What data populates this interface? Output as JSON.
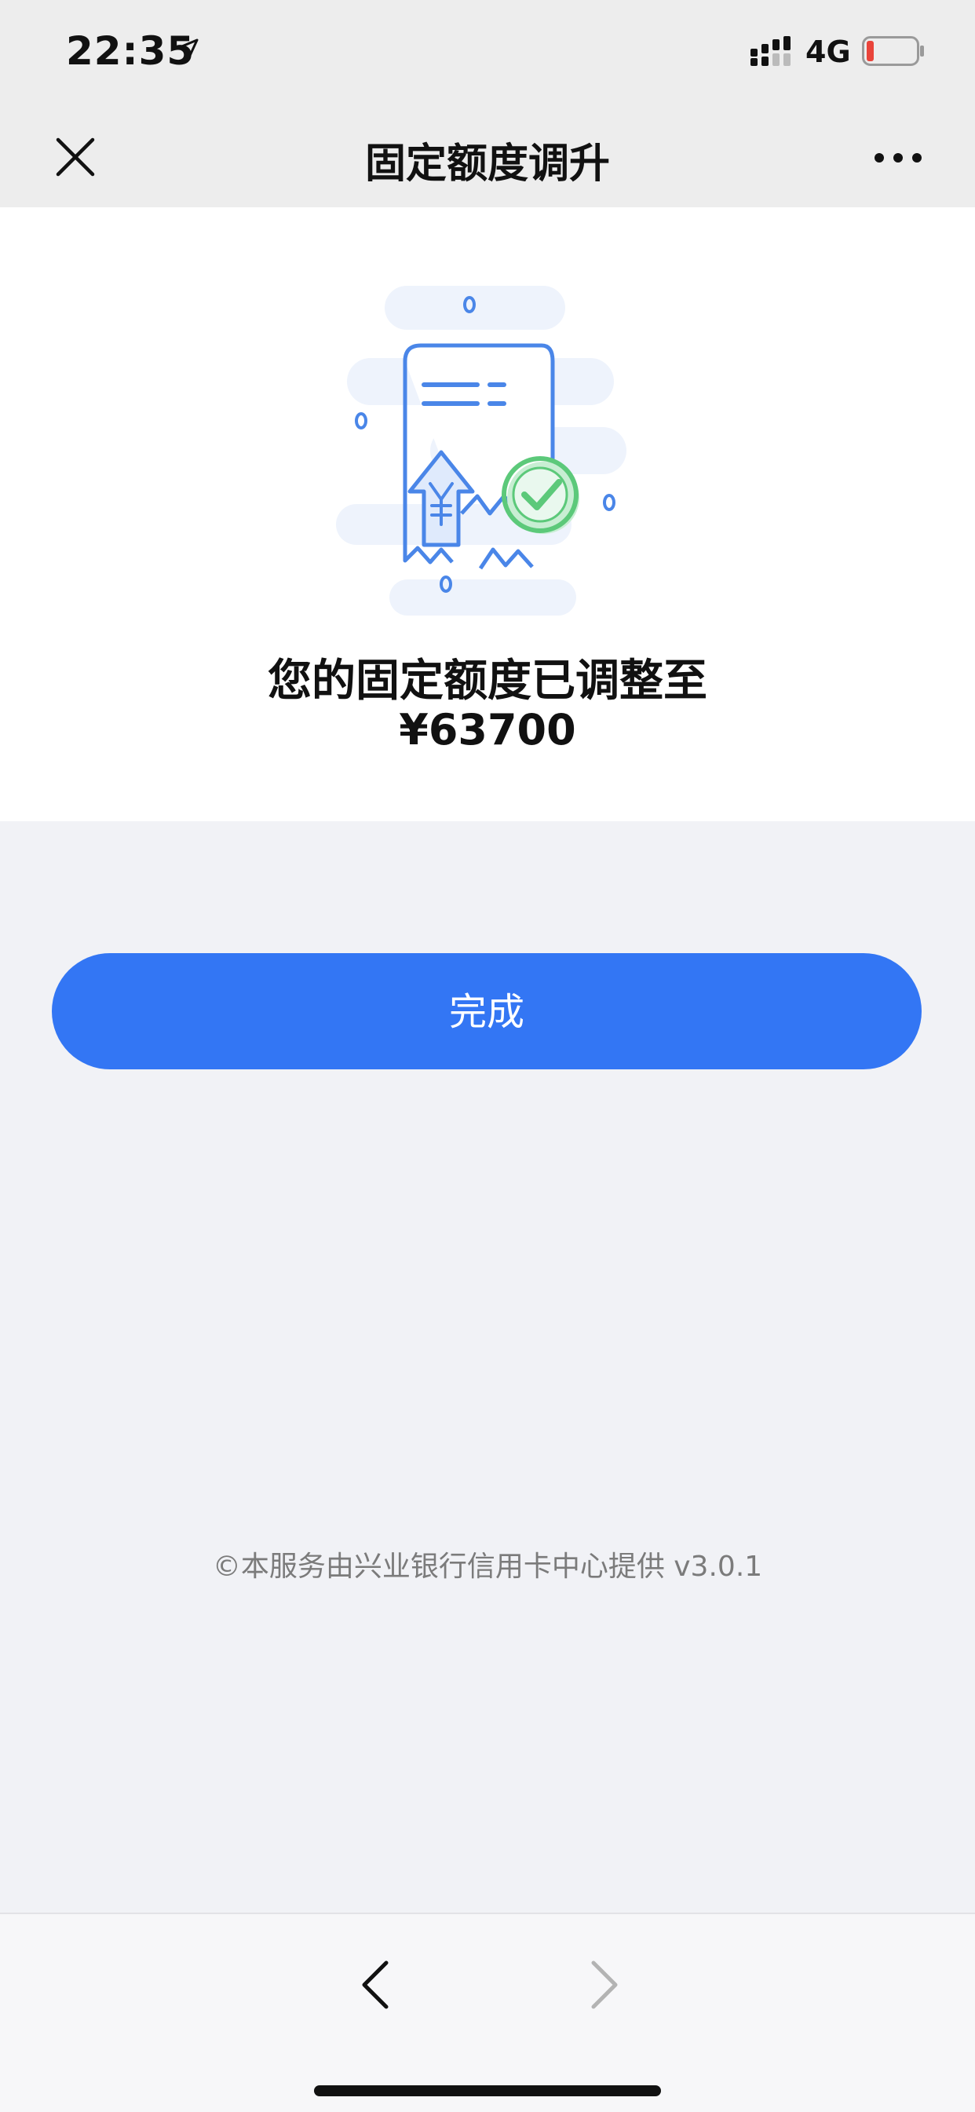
{
  "status_bar": {
    "time": "22:35",
    "network": "4G",
    "icons": [
      "location-arrow-icon",
      "signal-bars-icon",
      "battery-low-icon"
    ],
    "battery_color": "#e9443a"
  },
  "nav": {
    "title": "固定额度调升",
    "icons": [
      "close-icon",
      "more-dots-icon"
    ]
  },
  "result": {
    "message": "您的固定额度已调整至",
    "amount": "¥63700",
    "illustration_icon": "receipt-limit-increase-approved-icon"
  },
  "actions": {
    "done_label": "完成"
  },
  "footer": {
    "text": "©本服务由兴业银行信用卡中心提供 v3.0.1"
  },
  "toolbar": {
    "icons": [
      "back-chevron-icon",
      "forward-chevron-icon"
    ]
  },
  "colors": {
    "accent": "#3376f4",
    "success": "#5cc97a",
    "illustration_blue": "#4a86e8",
    "page_background": "#f1f2f6",
    "header_background": "#ededed"
  }
}
